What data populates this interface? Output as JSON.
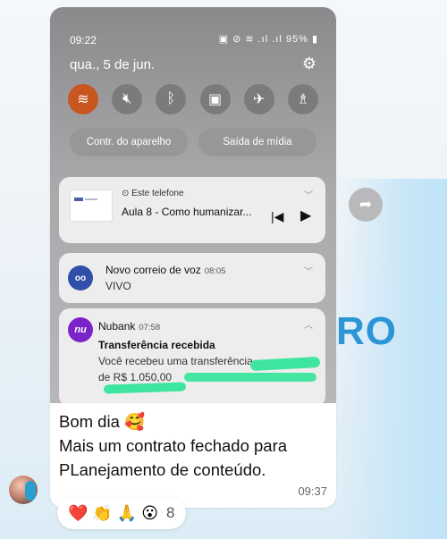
{
  "phone": {
    "time": "09:22",
    "status_icons": "95%",
    "date": "qua., 5 de jun.",
    "quick_settings": [
      "wifi",
      "mute",
      "bluetooth",
      "lock-rotation",
      "airplane",
      "flashlight"
    ],
    "pills": [
      "Contr. do aparelho",
      "Saída de mídia"
    ],
    "media": {
      "source": "Este telefone",
      "title": "Aula 8 - Como humanizar..."
    },
    "voicemail": {
      "title": "Novo correio de voz",
      "time": "08:05",
      "body": "VIVO"
    },
    "nubank": {
      "app_icon_text": "nu",
      "app": "Nubank",
      "time": "07:58",
      "title": "Transferência recebida",
      "line1": "Você recebeu uma transferência",
      "line2": "de R$ 1.050,00"
    }
  },
  "message": {
    "line1": "Bom dia 🥰",
    "line2": "Mais um contrato fechado para",
    "line3": "PLanejamento de conteúdo.",
    "time": "09:37"
  },
  "reactions": {
    "emojis": [
      "❤️",
      "👏",
      "🙏",
      "😮"
    ],
    "count": "8"
  },
  "background_text": "RO",
  "colors": {
    "wifi_active": "#c8561f",
    "nubank_purple": "#7a23c8",
    "redaction": "#3ee59e",
    "brand_blue": "#2b95d6"
  }
}
